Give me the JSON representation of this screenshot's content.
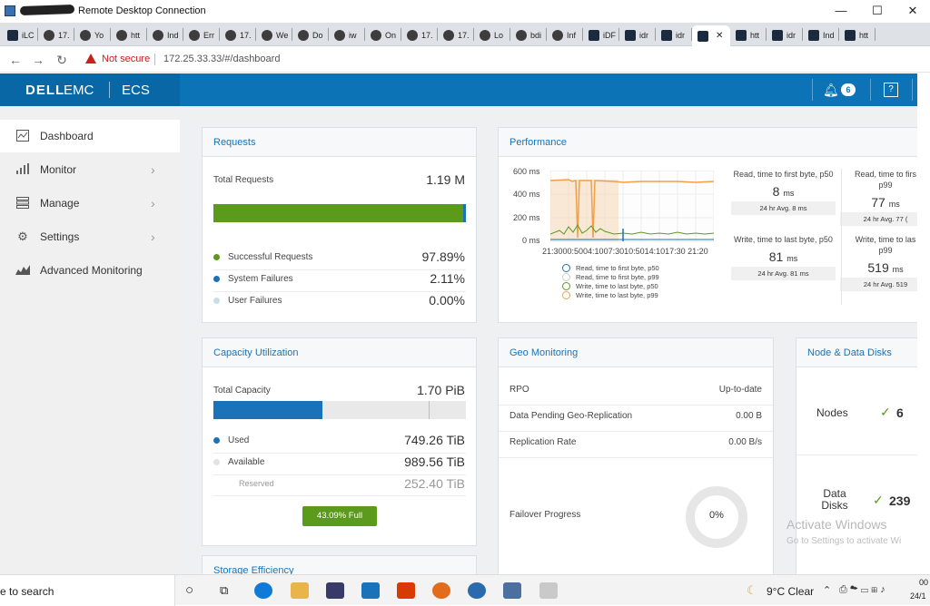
{
  "rdp": {
    "title": "Remote Desktop Connection",
    "minimize": "—",
    "maximize": "☐",
    "close": "✕"
  },
  "browser": {
    "tabs": [
      {
        "label": "iLC"
      },
      {
        "label": "17."
      },
      {
        "label": "Yo"
      },
      {
        "label": "htt"
      },
      {
        "label": "Ind"
      },
      {
        "label": "Err"
      },
      {
        "label": "17."
      },
      {
        "label": "We"
      },
      {
        "label": "Do"
      },
      {
        "label": "iw"
      },
      {
        "label": "On"
      },
      {
        "label": "17."
      },
      {
        "label": "17."
      },
      {
        "label": "Lo"
      },
      {
        "label": "bdi"
      },
      {
        "label": "Inf"
      },
      {
        "label": "iDF"
      },
      {
        "label": "idr"
      },
      {
        "label": "idr"
      },
      {
        "label": ""
      },
      {
        "label": "htt"
      },
      {
        "label": "idr"
      },
      {
        "label": "Ind"
      },
      {
        "label": "htt"
      }
    ],
    "active_tab_close": "✕",
    "not_secure": "Not secure",
    "url": "172.25.33.33/#/dashboard"
  },
  "header": {
    "brand_dell": "DELL",
    "brand_emc": "EMC",
    "product": "ECS",
    "notification_count": "6",
    "help": "?"
  },
  "sidebar": {
    "items": [
      {
        "label": "Dashboard",
        "icon": "dashboard-icon",
        "glyph": "⌁"
      },
      {
        "label": "Monitor",
        "icon": "monitor-icon",
        "glyph": "▁▃▅"
      },
      {
        "label": "Manage",
        "icon": "manage-icon",
        "glyph": "☰"
      },
      {
        "label": "Settings",
        "icon": "gear-icon",
        "glyph": "⚙"
      },
      {
        "label": "Advanced Monitoring",
        "icon": "advanced-monitoring-icon",
        "glyph": "▲"
      }
    ]
  },
  "requests": {
    "title": "Requests",
    "total_label": "Total Requests",
    "total_value": "1.19 M",
    "success_fraction": 0.989,
    "rows": [
      {
        "label": "Successful Requests",
        "value": "97.89%",
        "color": "#5c9a1b"
      },
      {
        "label": "System Failures",
        "value": "2.11%",
        "color": "#1a73b8"
      },
      {
        "label": "User Failures",
        "value": "0.00%",
        "color": "#c9dde9"
      }
    ]
  },
  "performance": {
    "title": "Performance",
    "y_ticks": [
      "600 ms",
      "400 ms",
      "200 ms",
      "0 ms"
    ],
    "x_ticks": "21:3000:5004:1007:3010:5014:1017:30 21:20",
    "legend": [
      "Read, time to first byte, p50",
      "Read, time to first byte, p99",
      "Write, time to last byte, p50",
      "Write, time to last byte, p99"
    ],
    "metrics": [
      {
        "label": "Read, time to first byte, p50",
        "value": "8",
        "unit": "ms",
        "avg": "24 hr Avg. 8 ms"
      },
      {
        "label": "Read, time to firs p99",
        "value": "77",
        "unit": "ms",
        "avg": "24 hr Avg. 77 ("
      },
      {
        "label": "Write, time to last byte, p50",
        "value": "81",
        "unit": "ms",
        "avg": "24 hr Avg. 81 ms"
      },
      {
        "label": "Write, time to las p99",
        "value": "519",
        "unit": "ms",
        "avg": "24 hr Avg. 519"
      }
    ]
  },
  "capacity": {
    "title": "Capacity Utilization",
    "total_label": "Total Capacity",
    "total_value": "1.70 PiB",
    "used_fraction": 0.43,
    "reserved_fraction": 0.852,
    "rows": [
      {
        "label": "Used",
        "value": "749.26 TiB",
        "color": "#1a73b8"
      },
      {
        "label": "Available",
        "value": "989.56 TiB",
        "color": "#e3e3e3"
      },
      {
        "label": "Reserved",
        "value": "252.40 TiB",
        "color": ""
      }
    ],
    "full_badge": "43.09% Full"
  },
  "storage_efficiency": {
    "title": "Storage Efficiency"
  },
  "geo": {
    "title": "Geo Monitoring",
    "rows": [
      {
        "label": "RPO",
        "value": "Up-to-date"
      },
      {
        "label": "Data Pending Geo-Replication",
        "value": "0.00 B"
      },
      {
        "label": "Replication Rate",
        "value": "0.00 B/s"
      }
    ],
    "failover_label": "Failover Progress",
    "failover_value": "0%"
  },
  "nodes": {
    "title": "Node & Data Disks",
    "nodes_label": "Nodes",
    "nodes_value": "6",
    "disks_label": "Data Disks",
    "disks_value": "239"
  },
  "watermark": {
    "line1": "Activate Windows",
    "line2": "Go to Settings to activate Wi"
  },
  "taskbar": {
    "search": "e to search",
    "weather": "9°C  Clear",
    "time": "00",
    "date": "24/1"
  }
}
